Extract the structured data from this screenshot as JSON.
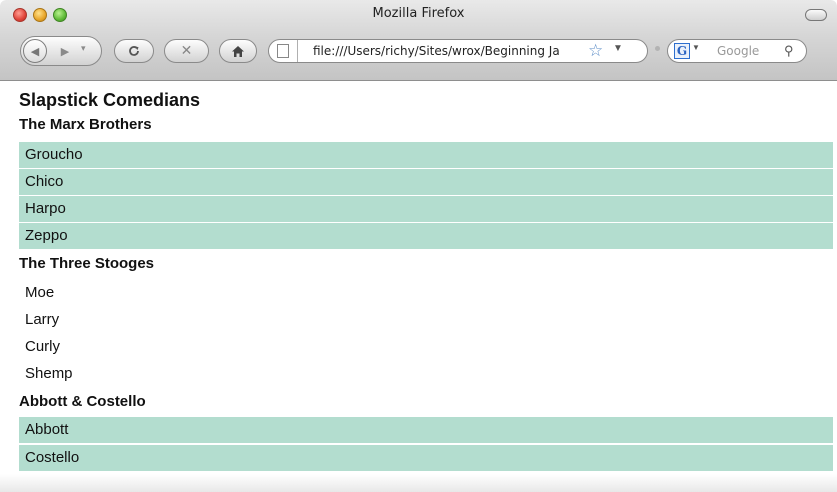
{
  "window": {
    "title": "Mozilla Firefox"
  },
  "toolbar": {
    "back_icon": "back-arrow",
    "forward_icon": "forward-arrow",
    "reload_icon": "reload",
    "stop_icon": "stop-x",
    "home_icon": "home",
    "url": "file:///Users/richy/Sites/wrox/Beginning Ja",
    "search_engine_letter": "G",
    "search_placeholder": "Google"
  },
  "page": {
    "title": "Slapstick Comedians",
    "highlight_color": "#b3ddcf",
    "groups": [
      {
        "heading": "The Marx Brothers",
        "highlighted": true,
        "members": [
          "Groucho",
          "Chico",
          "Harpo",
          "Zeppo"
        ]
      },
      {
        "heading": "The Three Stooges",
        "highlighted": false,
        "members": [
          "Moe",
          "Larry",
          "Curly",
          "Shemp"
        ]
      },
      {
        "heading": "Abbott & Costello",
        "highlighted": true,
        "members": [
          "Abbott",
          "Costello"
        ]
      }
    ]
  }
}
